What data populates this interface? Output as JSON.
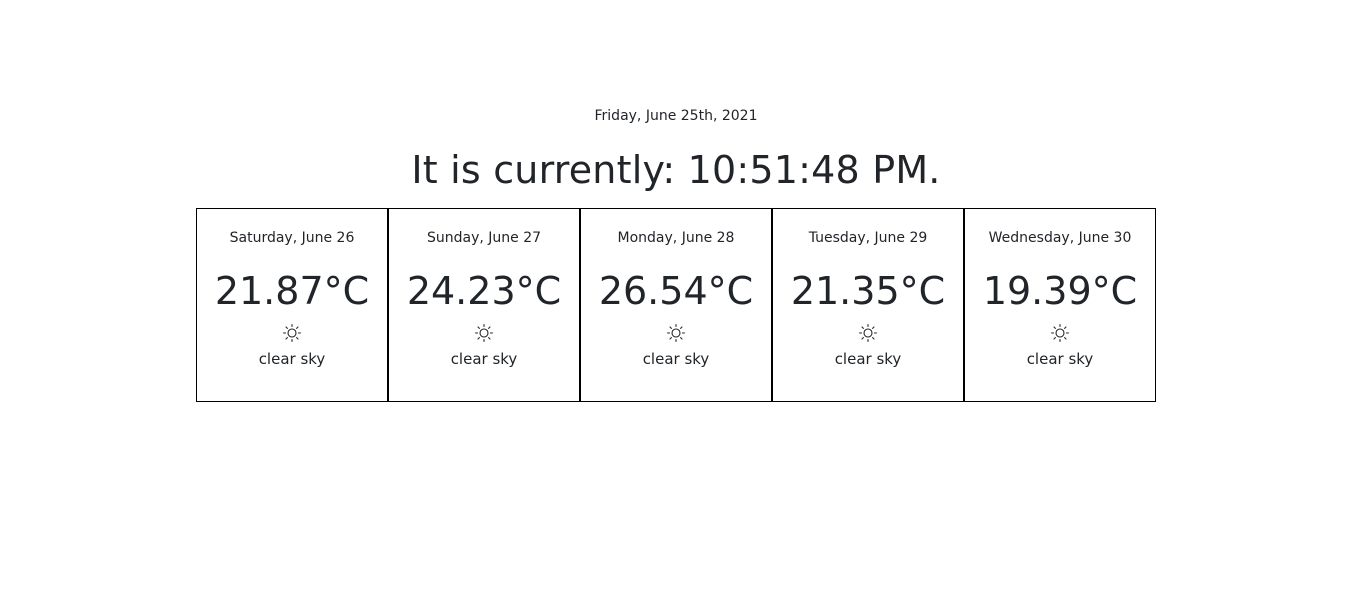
{
  "header": {
    "date": "Friday, June 25th, 2021",
    "clock": "It is currently: 10:51:48 PM."
  },
  "forecast": [
    {
      "day": "Saturday, June 26",
      "temp": "21.87°C",
      "icon": "sun-icon",
      "description": "clear sky"
    },
    {
      "day": "Sunday, June 27",
      "temp": "24.23°C",
      "icon": "sun-icon",
      "description": "clear sky"
    },
    {
      "day": "Monday, June 28",
      "temp": "26.54°C",
      "icon": "sun-icon",
      "description": "clear sky"
    },
    {
      "day": "Tuesday, June 29",
      "temp": "21.35°C",
      "icon": "sun-icon",
      "description": "clear sky"
    },
    {
      "day": "Wednesday, June 30",
      "temp": "19.39°C",
      "icon": "sun-icon",
      "description": "clear sky"
    }
  ]
}
